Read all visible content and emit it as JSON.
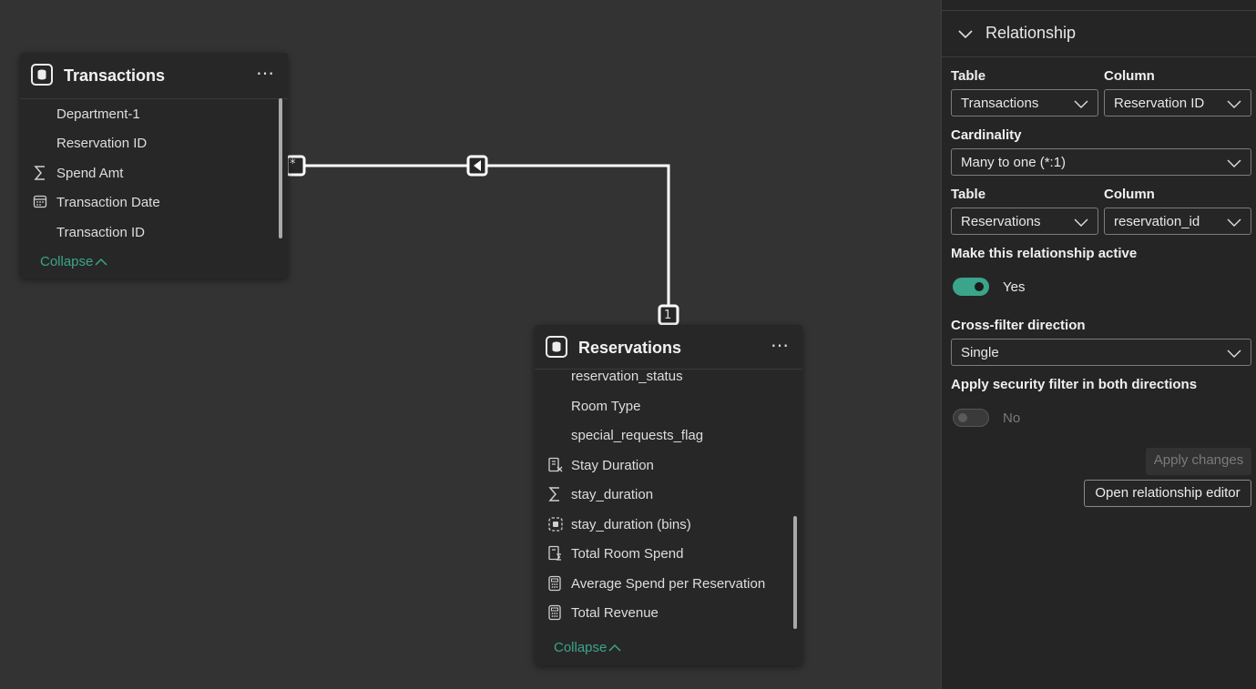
{
  "transactions_table": {
    "title": "Transactions",
    "more_label": "⋯",
    "fields": [
      {
        "label": "Department-1",
        "icon": ""
      },
      {
        "label": "Reservation ID",
        "icon": ""
      },
      {
        "label": "Spend Amt",
        "icon": "sigma-icon"
      },
      {
        "label": "Transaction Date",
        "icon": "calendar-icon"
      },
      {
        "label": "Transaction ID",
        "icon": ""
      }
    ],
    "collapse_label": "Collapse"
  },
  "reservations_table": {
    "title": "Reservations",
    "more_label": "⋯",
    "fields": [
      {
        "label": "reservation_status",
        "icon": ""
      },
      {
        "label": "Room Type",
        "icon": ""
      },
      {
        "label": "special_requests_flag",
        "icon": ""
      },
      {
        "label": "Stay Duration",
        "icon": "calculated-column-icon"
      },
      {
        "label": "stay_duration",
        "icon": "sigma-icon"
      },
      {
        "label": "stay_duration (bins)",
        "icon": "bins-icon"
      },
      {
        "label": "Total Room Spend",
        "icon": "calculated-table-icon"
      },
      {
        "label": "Average Spend per Reservation",
        "icon": "calculator-icon"
      },
      {
        "label": "Total Revenue",
        "icon": "calculator-icon"
      }
    ],
    "collapse_label": "Collapse"
  },
  "relationship_line": {
    "many_marker": "*",
    "one_marker": "1"
  },
  "properties_pane": {
    "section_title": "Relationship",
    "from": {
      "table_label": "Table",
      "table_value": "Transactions",
      "column_label": "Column",
      "column_value": "Reservation ID"
    },
    "cardinality_label": "Cardinality",
    "cardinality_value": "Many to one (*:1)",
    "to": {
      "table_label": "Table",
      "table_value": "Reservations",
      "column_label": "Column",
      "column_value": "reservation_id"
    },
    "active_label": "Make this relationship active",
    "active_value": "Yes",
    "crossfilter_label": "Cross-filter direction",
    "crossfilter_value": "Single",
    "security_label": "Apply security filter in both directions",
    "security_value": "No",
    "apply_button": "Apply changes",
    "editor_button": "Open relationship editor"
  },
  "colors": {
    "accent": "#3aa58a",
    "canvas": "#333333",
    "card": "#272727",
    "pane": "#252525"
  }
}
